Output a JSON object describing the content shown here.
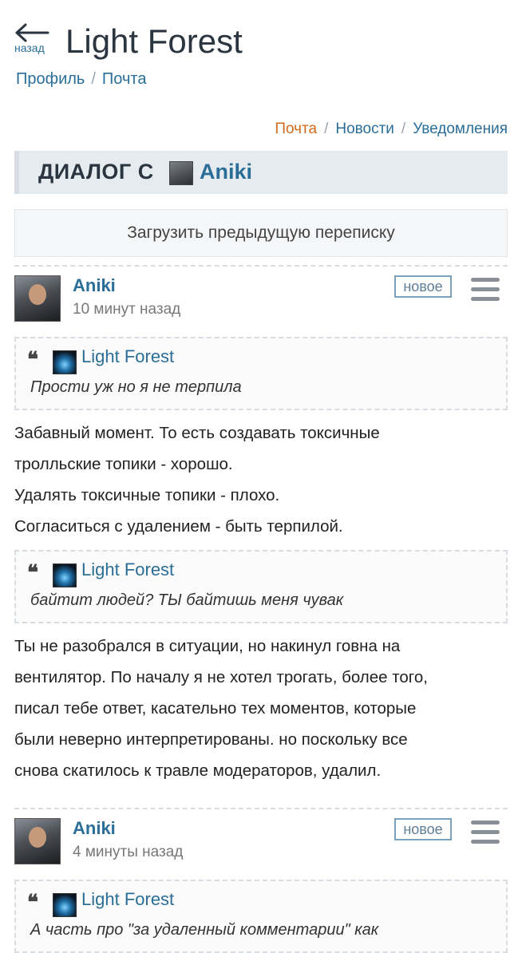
{
  "header": {
    "back_label": "назад",
    "title": "Light Forest"
  },
  "breadcrumbs": [
    "Профиль",
    "Почта"
  ],
  "subnav": {
    "items": [
      {
        "label": "Почта",
        "active": true
      },
      {
        "label": "Новости",
        "active": false
      },
      {
        "label": "Уведомления",
        "active": false
      }
    ]
  },
  "dialog": {
    "prefix": "ДИАЛОГ С",
    "user": "Aniki"
  },
  "load_previous": "Загрузить предыдущую переписку",
  "messages": [
    {
      "author": "Aniki",
      "time": "10 минут назад",
      "badge": "новое",
      "blocks": [
        {
          "type": "quote",
          "author": "Light Forest",
          "text": "Прости уж но я не терпила"
        },
        {
          "type": "text",
          "lines": [
            "Забавный момент. То есть создавать токсичные",
            "тролльские топики - хорошо.",
            "Удалять токсичные топики - плохо.",
            "Согласиться с удалением - быть терпилой."
          ]
        },
        {
          "type": "quote",
          "author": "Light Forest",
          "text": "байтит людей? ТЫ байтишь меня чувак"
        },
        {
          "type": "text",
          "lines": [
            "Ты не разобрался в ситуации, но накинул говна на",
            "вентилятор. По началу я не хотел трогать, более того,",
            "писал тебе ответ, касательно тех моментов, которые",
            "были неверно интерпретированы. но поскольку все",
            "снова скатилось к травле модераторов, удалил."
          ]
        }
      ]
    },
    {
      "author": "Aniki",
      "time": "4 минуты назад",
      "badge": "новое",
      "blocks": [
        {
          "type": "quote",
          "author": "Light Forest",
          "text": "А часть про \"за удаленный комментарии\" как"
        }
      ]
    }
  ],
  "icons": {
    "back": "arrow-left-icon",
    "menu": "hamburger-menu-icon",
    "quote": "quote-mark-icon"
  },
  "colors": {
    "link": "#2a6e97",
    "active_nav": "#d2691e",
    "dialog_bar": "#e6ebf0"
  }
}
